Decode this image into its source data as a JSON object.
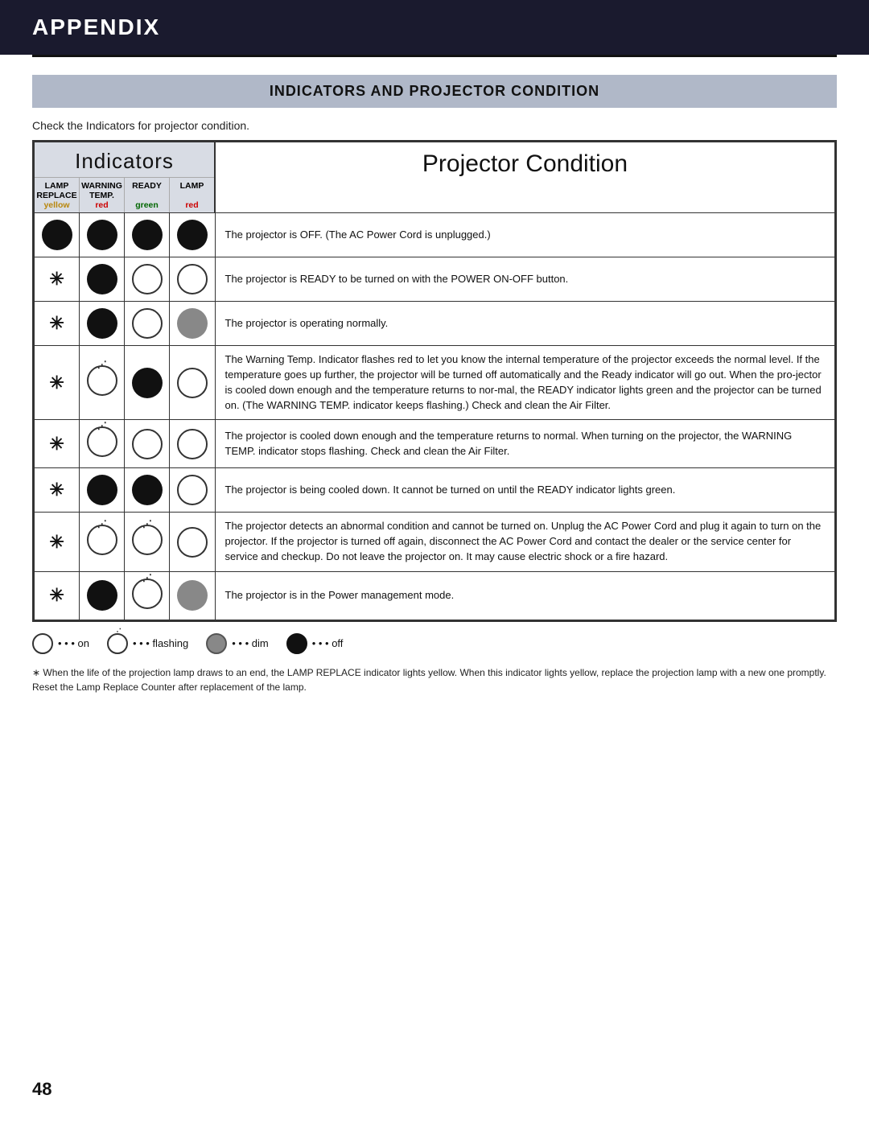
{
  "header": {
    "title": "APPENDIX"
  },
  "section": {
    "title": "INDICATORS AND PROJECTOR CONDITION"
  },
  "intro": "Check the Indicators for projector condition.",
  "table": {
    "indicators_label": "Indicators",
    "projector_condition_label": "Projector Condition",
    "columns": [
      {
        "id": "lamp_replace",
        "line1": "LAMP",
        "line2": "REPLACE",
        "color": "yellow"
      },
      {
        "id": "warning_temp",
        "line1": "WARNING",
        "line2": "TEMP.",
        "color": "red"
      },
      {
        "id": "ready",
        "line1": "READY",
        "line2": "",
        "color": "green"
      },
      {
        "id": "lamp",
        "line1": "LAMP",
        "line2": "",
        "color": "red"
      }
    ],
    "rows": [
      {
        "lamp_replace": "off",
        "warning_temp": "off",
        "ready": "off",
        "lamp": "off",
        "condition": "The projector is OFF.  (The AC Power Cord is unplugged.)"
      },
      {
        "lamp_replace": "asterisk",
        "warning_temp": "off",
        "ready": "on",
        "lamp": "on",
        "condition": "The projector is READY to be turned on with the POWER ON-OFF button."
      },
      {
        "lamp_replace": "asterisk",
        "warning_temp": "off",
        "ready": "on",
        "lamp": "dim",
        "condition": "The projector is operating normally."
      },
      {
        "lamp_replace": "asterisk",
        "warning_temp": "flashing",
        "ready": "off",
        "lamp": "on",
        "condition": "The Warning Temp. Indicator flashes red to let you know the internal temperature of the projector exceeds the normal level. If the temperature goes up further, the projector will be turned off automatically and the Ready indicator will go out.  When  the pro-jector is cooled down enough and the temperature returns to nor-mal, the READY indicator lights green and the projector can be turned on.  (The WARNING TEMP. indicator keeps flashing.)  Check and clean the Air Filter."
      },
      {
        "lamp_replace": "asterisk",
        "warning_temp": "flashing",
        "ready": "on",
        "lamp": "on",
        "condition": "The projector is cooled down enough and the temperature returns to normal.  When turning on the projector, the WARNING TEMP. indicator stops flashing.  Check and clean the Air Filter."
      },
      {
        "lamp_replace": "asterisk",
        "warning_temp": "off",
        "ready": "off",
        "lamp": "on",
        "condition": "The projector is being cooled down. It cannot be turned on until the READY indicator lights green."
      },
      {
        "lamp_replace": "asterisk",
        "warning_temp": "flashing",
        "ready": "flashing",
        "lamp": "on",
        "condition": "The projector detects an abnormal condition and cannot be turned on.  Unplug the AC Power Cord and plug it again to turn on the projector.  If the projector is turned off again, disconnect the AC Power Cord and contact the dealer or the service center for service and checkup.  Do not leave the projector on.  It may cause electric shock or a fire hazard."
      },
      {
        "lamp_replace": "asterisk",
        "warning_temp": "off",
        "ready": "flashing",
        "lamp": "dim",
        "condition": "The projector is in the Power management mode."
      }
    ]
  },
  "legend": {
    "on_label": "• • • on",
    "flashing_label": "• • • flashing",
    "dim_label": "• • • dim",
    "off_label": "• • • off"
  },
  "footnote": "∗ When the life of the projection lamp draws to an end, the LAMP REPLACE indicator lights yellow.  When this indicator lights yellow, replace the projection lamp with a new one promptly.  Reset the Lamp Replace Counter after replacement of the lamp.",
  "page_number": "48"
}
